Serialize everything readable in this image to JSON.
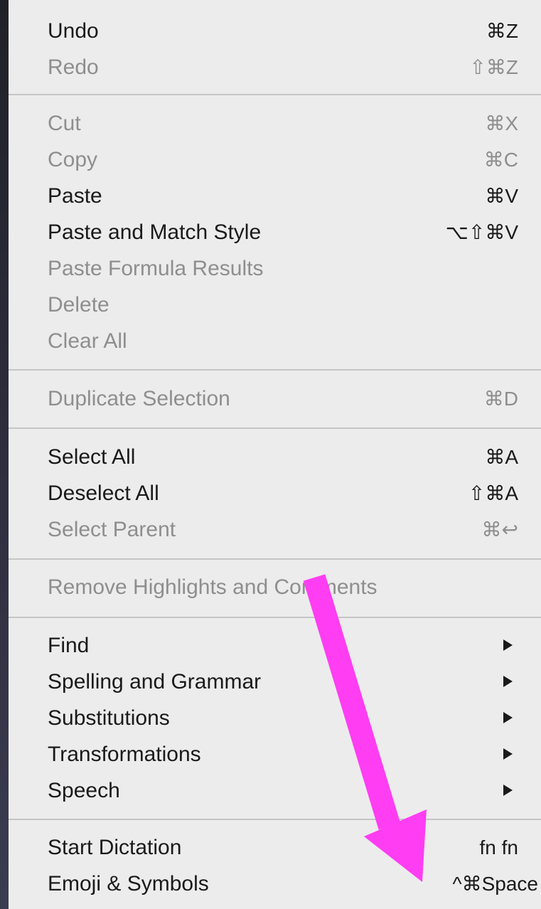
{
  "menu": {
    "groups": [
      {
        "items": [
          {
            "label": "Undo",
            "shortcut": "⌘Z",
            "enabled": true
          },
          {
            "label": "Redo",
            "shortcut": "⇧⌘Z",
            "enabled": false
          }
        ]
      },
      {
        "items": [
          {
            "label": "Cut",
            "shortcut": "⌘X",
            "enabled": false
          },
          {
            "label": "Copy",
            "shortcut": "⌘C",
            "enabled": false
          },
          {
            "label": "Paste",
            "shortcut": "⌘V",
            "enabled": true
          },
          {
            "label": "Paste and Match Style",
            "shortcut": "⌥⇧⌘V",
            "enabled": true
          },
          {
            "label": "Paste Formula Results",
            "shortcut": "",
            "enabled": false
          },
          {
            "label": "Delete",
            "shortcut": "",
            "enabled": false
          },
          {
            "label": "Clear All",
            "shortcut": "",
            "enabled": false
          }
        ]
      },
      {
        "items": [
          {
            "label": "Duplicate Selection",
            "shortcut": "⌘D",
            "enabled": false
          }
        ]
      },
      {
        "items": [
          {
            "label": "Select All",
            "shortcut": "⌘A",
            "enabled": true
          },
          {
            "label": "Deselect All",
            "shortcut": "⇧⌘A",
            "enabled": true
          },
          {
            "label": "Select Parent",
            "shortcut": "⌘↩",
            "enabled": false
          }
        ]
      },
      {
        "items": [
          {
            "label": "Remove Highlights and Comments",
            "shortcut": "",
            "enabled": false
          }
        ]
      },
      {
        "items": [
          {
            "label": "Find",
            "shortcut": "",
            "enabled": true,
            "submenu": true
          },
          {
            "label": "Spelling and Grammar",
            "shortcut": "",
            "enabled": true,
            "submenu": true
          },
          {
            "label": "Substitutions",
            "shortcut": "",
            "enabled": true,
            "submenu": true
          },
          {
            "label": "Transformations",
            "shortcut": "",
            "enabled": true,
            "submenu": true
          },
          {
            "label": "Speech",
            "shortcut": "",
            "enabled": true,
            "submenu": true
          }
        ]
      },
      {
        "items": [
          {
            "label": "Start Dictation",
            "shortcut": "fn fn",
            "enabled": true
          },
          {
            "label": "Emoji & Symbols",
            "shortcut": "^⌘Space",
            "enabled": true
          }
        ]
      }
    ]
  },
  "annotation": {
    "arrow_color": "#ff3df2",
    "icon": "arrow-down-right-icon"
  }
}
